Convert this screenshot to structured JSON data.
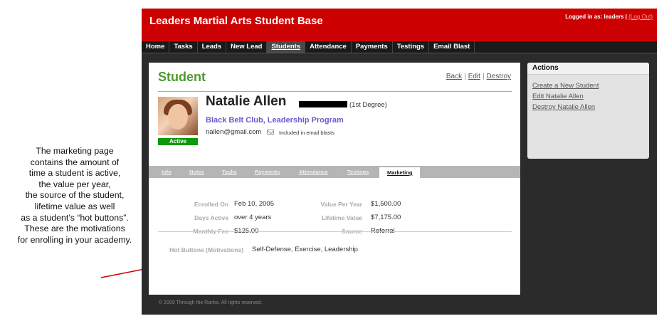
{
  "caption": {
    "lines": [
      "The marketing page",
      "contains the amount of",
      "time a student is active,",
      "the value per year,",
      "the source of the student,",
      "lifetime value as well",
      "as a student’s “hot buttons”.",
      "These are the motivations",
      "for enrolling in your academy."
    ]
  },
  "header": {
    "title": "Leaders Martial Arts Student Base",
    "logged_in_prefix": "Logged in as: leaders | ",
    "logout": "(Log Out)"
  },
  "nav": {
    "items": [
      "Home",
      "Tasks",
      "Leads",
      "New Lead",
      "Students",
      "Attendance",
      "Payments",
      "Testings",
      "Email Blast"
    ],
    "active": "Students"
  },
  "page": {
    "title": "Student",
    "links": {
      "back": "Back",
      "edit": "Edit",
      "destroy": "Destroy",
      "sep": "|"
    }
  },
  "student": {
    "name": "Natalie Allen",
    "degree": "(1st Degree)",
    "programs": "Black Belt Club, Leadership Program",
    "email": "nallen@gmail.com",
    "email_note": "Included in email blasts",
    "status": "Active"
  },
  "tabs": {
    "items": [
      "Info",
      "Notes",
      "Tasks",
      "Payments",
      "Attendance",
      "Testings",
      "Marketing"
    ],
    "active": "Marketing"
  },
  "marketing": {
    "enrolled_on_label": "Enrolled On",
    "enrolled_on": "Feb 10, 2005",
    "days_active_label": "Days Active",
    "days_active": "over 4 years",
    "monthly_fee_label": "Monthly Fee",
    "monthly_fee": "$125.00",
    "value_per_year_label": "Value Per Year",
    "value_per_year": "$1,500.00",
    "lifetime_value_label": "Lifetime Value",
    "lifetime_value": "$7,175.00",
    "source_label": "Source",
    "source": "Referral",
    "hot_buttons_label": "Hot Buttons (Motivations)",
    "hot_buttons": "Self-Defense, Exercise, Leadership"
  },
  "footer": {
    "text": "© 2009 Through the Ranks. All rights reserved."
  },
  "actions": {
    "title": "Actions",
    "items": [
      "Create a New Student",
      "Edit Natalie Allen",
      "Destroy Natalie Allen"
    ]
  },
  "colors": {
    "header_red": "#cc0000",
    "title_green": "#4f9a2f",
    "program_purple": "#6a5acd",
    "active_green": "#0a9a0a",
    "arrow_red": "#cc0000"
  }
}
